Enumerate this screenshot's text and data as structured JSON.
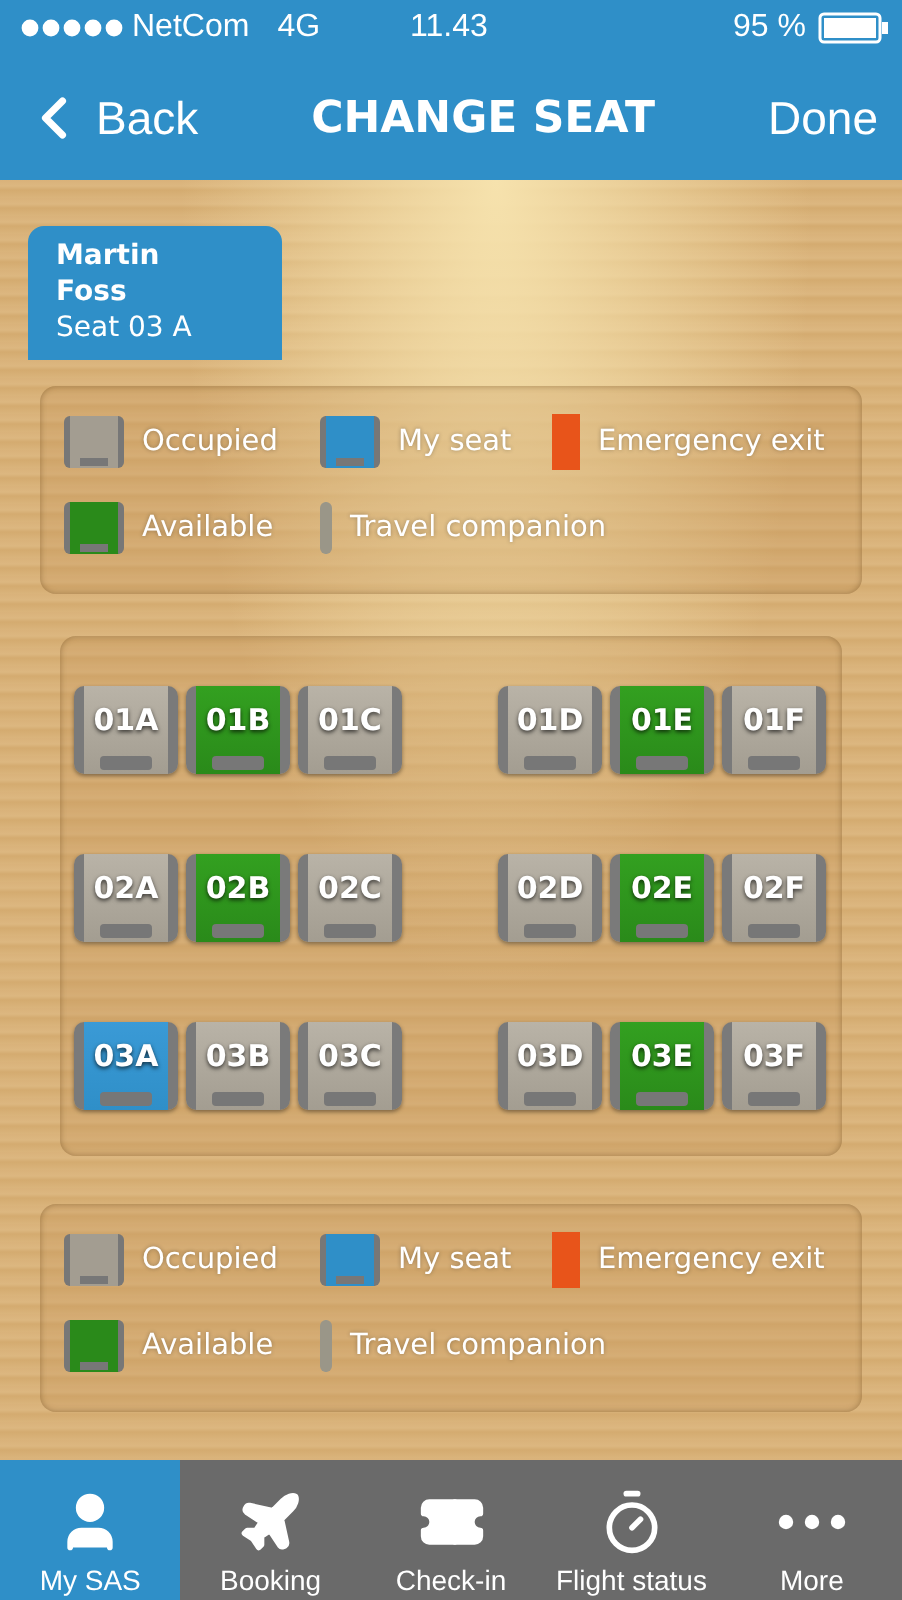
{
  "status_bar": {
    "carrier": "NetCom",
    "network": "4G",
    "time": "11.43",
    "battery": "95 %"
  },
  "nav": {
    "back": "Back",
    "title": "CHANGE SEAT",
    "done": "Done"
  },
  "passenger": {
    "first_name": "Martin",
    "last_name": "Foss",
    "seat": "Seat 03 A",
    "selected": true
  },
  "legend_top": [
    {
      "kind": "occupied",
      "label": "Occupied"
    },
    {
      "kind": "mine",
      "label": "My seat"
    },
    {
      "kind": "exit",
      "label": "Emergency exit"
    },
    {
      "kind": "available",
      "label": "Available"
    },
    {
      "kind": "companion",
      "label": "Travel companion"
    }
  ],
  "seat_rows": [
    [
      {
        "label": "01A",
        "kind": "occupied"
      },
      {
        "label": "01B",
        "kind": "available"
      },
      {
        "label": "01C",
        "kind": "occupied"
      },
      {
        "label": "01D",
        "kind": "occupied"
      },
      {
        "label": "01E",
        "kind": "available"
      },
      {
        "label": "01F",
        "kind": "occupied"
      }
    ],
    [
      {
        "label": "02A",
        "kind": "occupied"
      },
      {
        "label": "02B",
        "kind": "available"
      },
      {
        "label": "02C",
        "kind": "occupied"
      },
      {
        "label": "02D",
        "kind": "occupied"
      },
      {
        "label": "02E",
        "kind": "available"
      },
      {
        "label": "02F",
        "kind": "occupied"
      }
    ],
    [
      {
        "label": "03A",
        "kind": "mine"
      },
      {
        "label": "03B",
        "kind": "occupied"
      },
      {
        "label": "03C",
        "kind": "occupied"
      },
      {
        "label": "03D",
        "kind": "occupied"
      },
      {
        "label": "03E",
        "kind": "available"
      },
      {
        "label": "03F",
        "kind": "occupied"
      }
    ]
  ],
  "legend_bottom": [
    {
      "kind": "occupied",
      "label": "Occupied"
    },
    {
      "kind": "mine",
      "label": "My seat"
    },
    {
      "kind": "exit",
      "label": "Emergency exit"
    },
    {
      "kind": "available",
      "label": "Available"
    },
    {
      "kind": "companion",
      "label": "Travel companion"
    }
  ],
  "tab_bar": [
    {
      "label": "My SAS",
      "selected": true
    },
    {
      "label": "Booking",
      "selected": false
    },
    {
      "label": "Check-in",
      "selected": false
    },
    {
      "label": "Flight status",
      "selected": false
    },
    {
      "label": "More",
      "selected": false
    }
  ]
}
